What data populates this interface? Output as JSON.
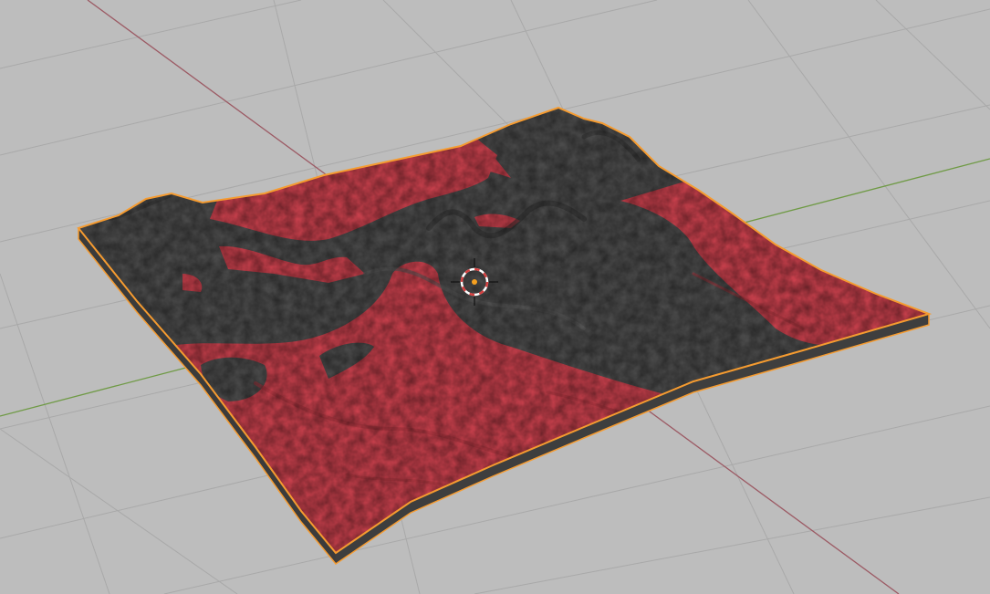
{
  "viewport": {
    "background_color": "#bdbdbd",
    "grid_color": "#a9a9a9",
    "x_axis_color": "#9c5a64",
    "y_axis_color": "#6f9a45"
  },
  "terrain_object": {
    "selected": true,
    "outline_color": "#f59b30",
    "dark_material_color": "#4b4b4b",
    "red_material_color": "#c8404c",
    "side_color": "#3b3b3b"
  },
  "cursor_3d": {
    "ring_color_a": "#d44040",
    "ring_color_b": "#ffffff",
    "center_color": "#f5a020"
  }
}
